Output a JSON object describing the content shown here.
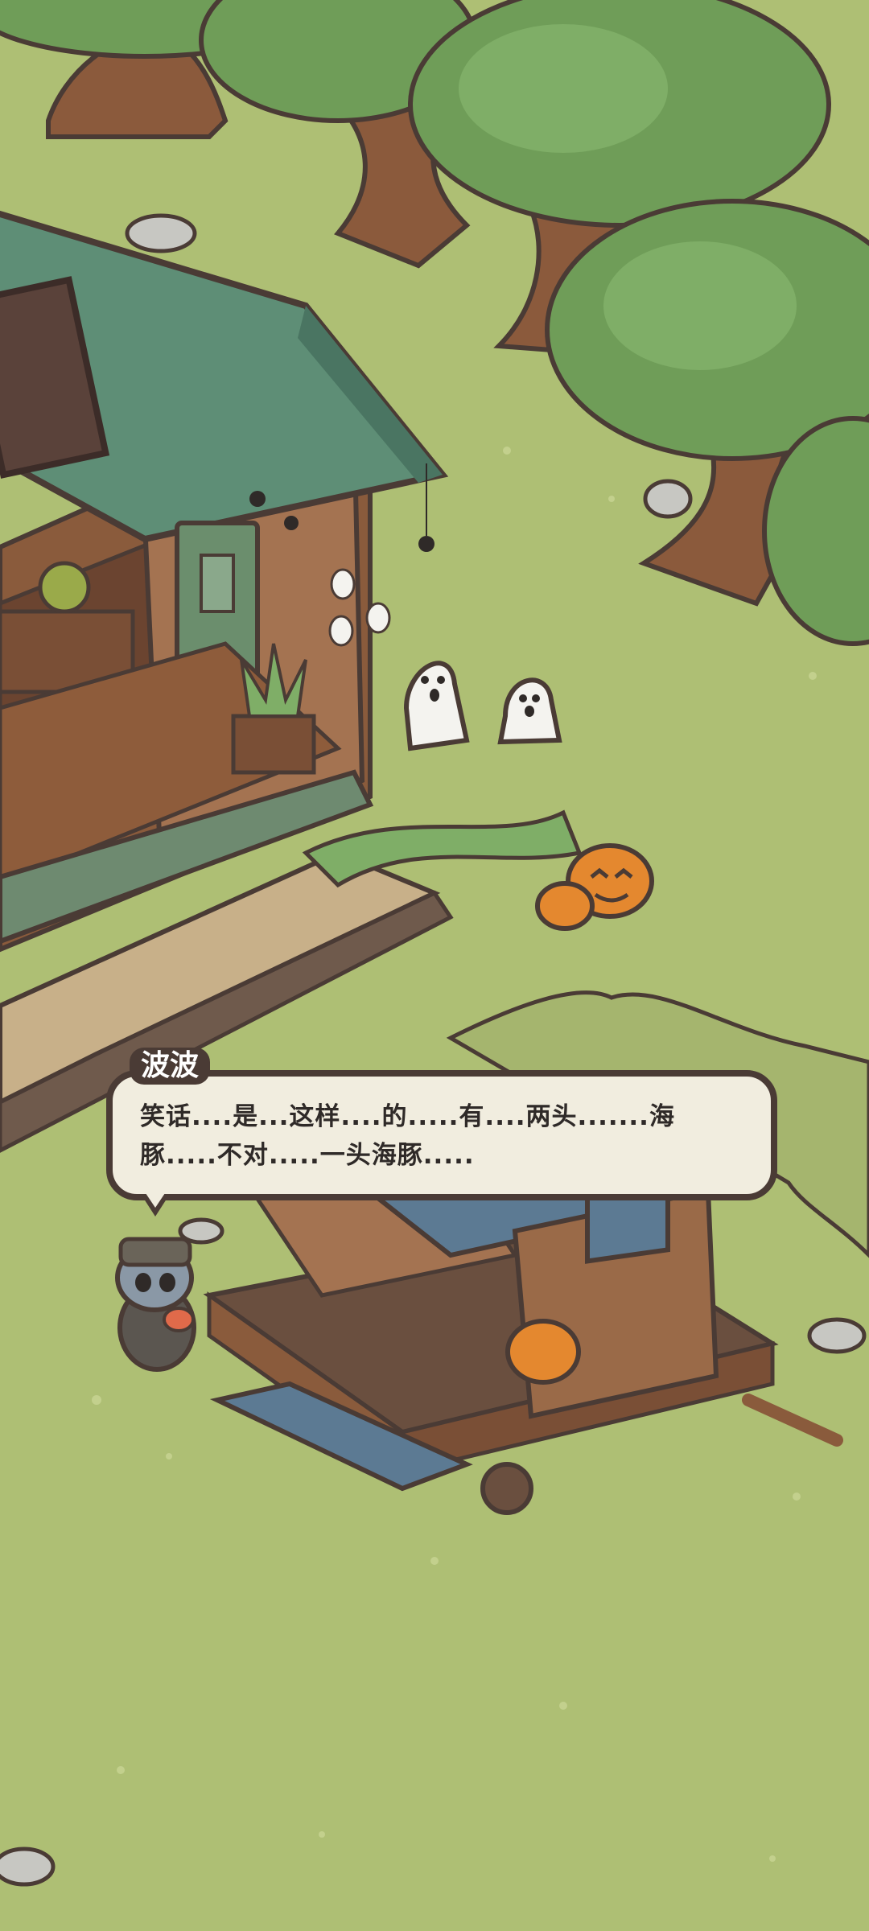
{
  "dialog": {
    "speaker": "波波",
    "lines": "笑话....是...这样....的.....有....两头.......海\n豚.....不对.....一头海豚....."
  },
  "colors": {
    "grass": "#aebf74",
    "tree_canopy": "#6f9d58",
    "trunk": "#8b5a3c",
    "roof": "#5e8e76",
    "wood": "#8a5b3c",
    "dialog_bg": "#f1eddf",
    "dialog_border": "#4a3b35"
  }
}
